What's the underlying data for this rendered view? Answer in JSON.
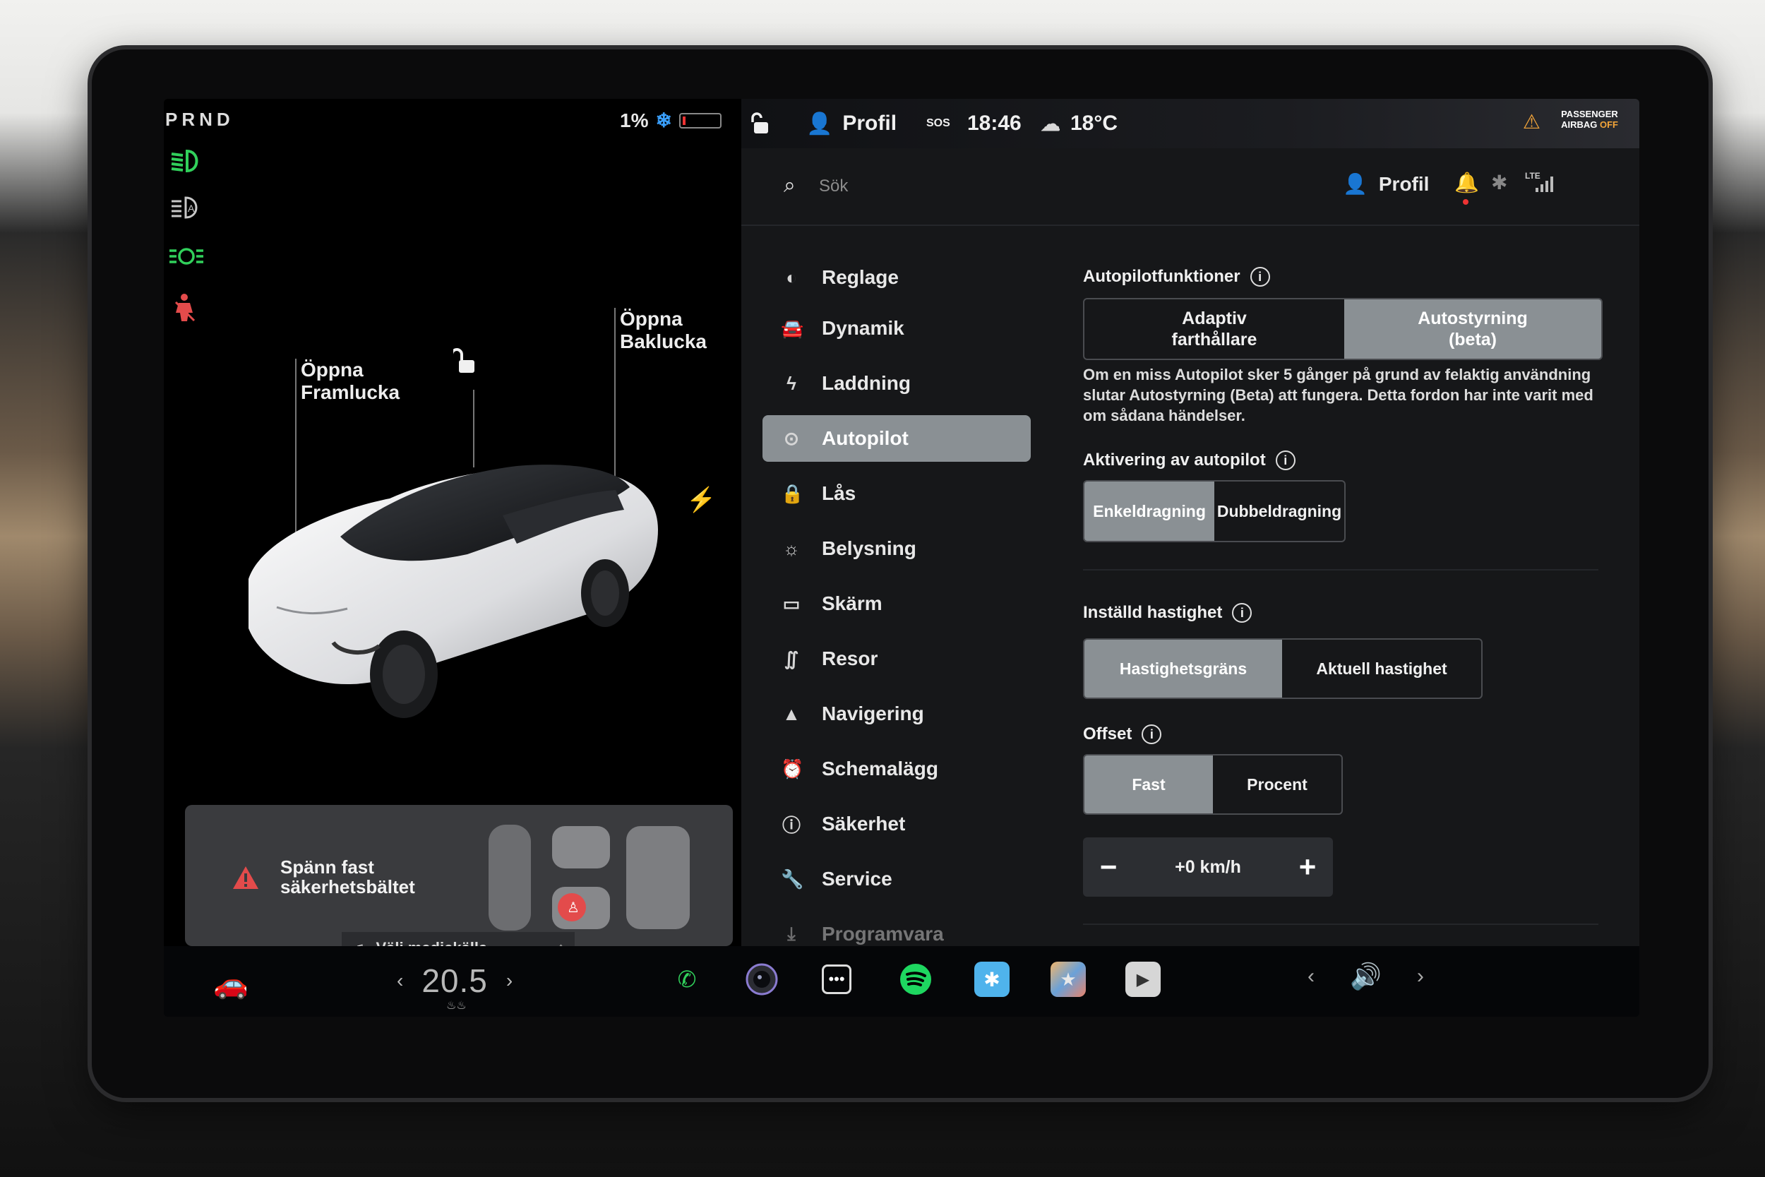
{
  "car_panel": {
    "gear": "PRND",
    "battery_percent": "1%",
    "labels": {
      "frunk_line1": "Öppna",
      "frunk_line2": "Framlucka",
      "trunk_line1": "Öppna",
      "trunk_line2": "Baklucka"
    },
    "seatbelt": {
      "line1": "Spänn fast",
      "line2": "säkerhetsbältet"
    },
    "media_chip": "Välj mediekälla"
  },
  "topbar": {
    "profile": "Profil",
    "time": "18:46",
    "temperature": "18°C",
    "sos": "SOS",
    "airbag_line1": "PASSENGER",
    "airbag_line2": "AIRBAG",
    "airbag_off": "OFF"
  },
  "search": {
    "placeholder": "Sök",
    "profile": "Profil",
    "network": "LTE"
  },
  "menu": {
    "items": [
      {
        "label": "Reglage",
        "icon": "toggle-icon"
      },
      {
        "label": "Dynamik",
        "icon": "car-icon"
      },
      {
        "label": "Laddning",
        "icon": "bolt-icon"
      },
      {
        "label": "Autopilot",
        "icon": "steering-wheel-icon"
      },
      {
        "label": "Lås",
        "icon": "lock-icon"
      },
      {
        "label": "Belysning",
        "icon": "sun-icon"
      },
      {
        "label": "Skärm",
        "icon": "display-icon"
      },
      {
        "label": "Resor",
        "icon": "trips-icon"
      },
      {
        "label": "Navigering",
        "icon": "navigation-icon"
      },
      {
        "label": "Schemalägg",
        "icon": "alarm-icon"
      },
      {
        "label": "Säkerhet",
        "icon": "safety-icon"
      },
      {
        "label": "Service",
        "icon": "wrench-icon"
      },
      {
        "label": "Programvara",
        "icon": "download-icon"
      }
    ],
    "active": "Autopilot"
  },
  "autopilot": {
    "features_title": "Autopilotfunktioner",
    "features_options": [
      "Adaptiv farthållare",
      "Autostyrning (beta)"
    ],
    "features_selected": "Autostyrning (beta)",
    "features_opt1_line1": "Adaptiv",
    "features_opt1_line2": "farthållare",
    "features_opt2_line1": "Autostyrning",
    "features_opt2_line2": "(beta)",
    "description": "Om en miss Autopilot sker 5 gånger på grund av felaktig användning slutar Autostyrning (Beta) att fungera. Detta fordon har inte varit med om sådana händelser.",
    "activation_title": "Aktivering av autopilot",
    "activation_options": [
      "Enkeldragning",
      "Dubbeldragning"
    ],
    "activation_selected": "Enkeldragning",
    "speed_title": "Inställd hastighet",
    "speed_options": [
      "Hastighetsgräns",
      "Aktuell hastighet"
    ],
    "speed_selected": "Hastighetsgräns",
    "offset_title": "Offset",
    "offset_options": [
      "Fast",
      "Procent"
    ],
    "offset_selected": "Fast",
    "offset_value": "+0 km/h",
    "minus": "−",
    "plus": "+"
  },
  "dock": {
    "cabin_temp": "20.5",
    "apps": [
      "phone-icon",
      "camera-icon",
      "more-icon",
      "spotify-icon",
      "bluetooth-icon",
      "toybox-icon",
      "theater-icon"
    ]
  },
  "colors": {
    "active_bg": "#8a9094",
    "panel_bg": "#161719",
    "warning": "#e34b4b",
    "green_indicator": "#31d05b",
    "airbag_off": "#f3a53a"
  }
}
